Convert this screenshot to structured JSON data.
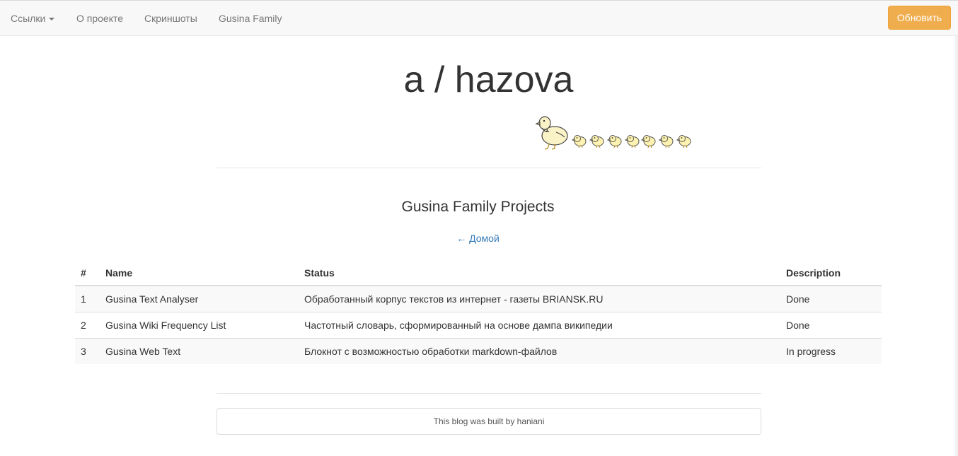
{
  "navbar": {
    "links": [
      "Ссылки",
      "О проекте",
      "Скриншоты",
      "Gusina Family"
    ],
    "update_button": "Обновить"
  },
  "header": {
    "title": "a / hazova",
    "ducks_image": "mother-duck-with-seven-ducklings"
  },
  "main": {
    "subtitle": "Gusina Family Projects",
    "home_link": "← Домой",
    "table": {
      "columns": [
        "#",
        "Name",
        "Status",
        "Description"
      ],
      "rows": [
        [
          "1",
          "Gusina Text Analyser",
          "Обработанный корпус текстов из интернет - газеты BRIANSK.RU",
          "Done"
        ],
        [
          "2",
          "Gusina Wiki Frequency List",
          "Частотный словарь, сформированный на основе дампа википедии",
          "Done"
        ],
        [
          "3",
          "Gusina Web Text",
          "Блокнот с возможностью обработки markdown-файлов",
          "In progress"
        ]
      ]
    }
  },
  "footer": {
    "text": "This blog was built by haniani"
  },
  "colors": {
    "accent_button": "#f0ad4e",
    "link": "#337ab7",
    "navbar_bg": "#f8f8f8"
  }
}
